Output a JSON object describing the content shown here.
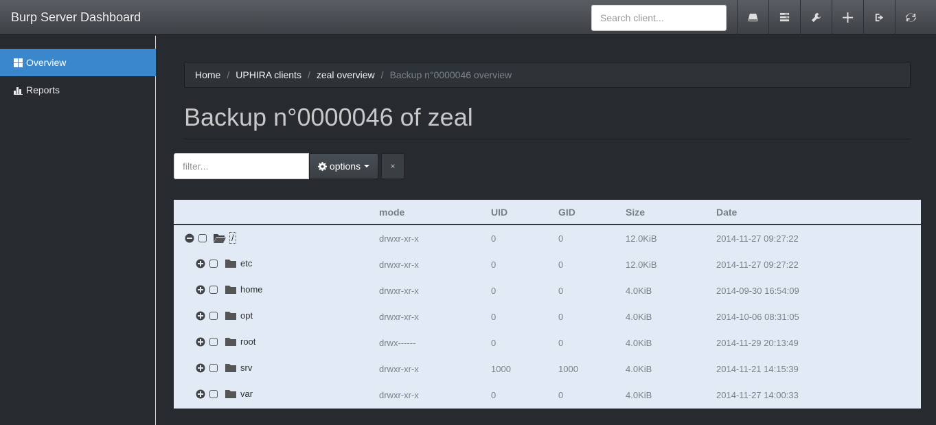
{
  "app": {
    "title": "Burp Server Dashboard"
  },
  "navbar": {
    "search_placeholder": "Search client...",
    "icons": [
      "hdd-icon",
      "tasks-icon",
      "wrench-icon",
      "screenshot-icon",
      "log-out-icon",
      "refresh-icon"
    ]
  },
  "sidebar": {
    "items": [
      {
        "label": "Overview",
        "icon": "th-large-icon",
        "active": true
      },
      {
        "label": "Reports",
        "icon": "stats-icon",
        "active": false
      }
    ]
  },
  "breadcrumb": [
    "Home",
    "UPHIRA clients",
    "zeal overview",
    "Backup n°0000046 overview"
  ],
  "page": {
    "title": "Backup n°0000046 of zeal"
  },
  "filter": {
    "placeholder": "filter...",
    "options_label": "options",
    "clear_label": "×"
  },
  "table": {
    "columns": [
      "",
      "mode",
      "UID",
      "GID",
      "Size",
      "Date"
    ],
    "rows": [
      {
        "name": "/",
        "expanded": true,
        "mode": "drwxr-xr-x",
        "uid": "0",
        "gid": "0",
        "size": "12.0KiB",
        "date": "2014-11-27 09:27:22"
      },
      {
        "name": "etc",
        "expanded": false,
        "mode": "drwxr-xr-x",
        "uid": "0",
        "gid": "0",
        "size": "12.0KiB",
        "date": "2014-11-27 09:27:22"
      },
      {
        "name": "home",
        "expanded": false,
        "mode": "drwxr-xr-x",
        "uid": "0",
        "gid": "0",
        "size": "4.0KiB",
        "date": "2014-09-30 16:54:09"
      },
      {
        "name": "opt",
        "expanded": false,
        "mode": "drwxr-xr-x",
        "uid": "0",
        "gid": "0",
        "size": "4.0KiB",
        "date": "2014-10-06 08:31:05"
      },
      {
        "name": "root",
        "expanded": false,
        "mode": "drwx------",
        "uid": "0",
        "gid": "0",
        "size": "4.0KiB",
        "date": "2014-11-29 20:13:49"
      },
      {
        "name": "srv",
        "expanded": false,
        "mode": "drwxr-xr-x",
        "uid": "1000",
        "gid": "1000",
        "size": "4.0KiB",
        "date": "2014-11-21 14:15:39"
      },
      {
        "name": "var",
        "expanded": false,
        "mode": "drwxr-xr-x",
        "uid": "0",
        "gid": "0",
        "size": "4.0KiB",
        "date": "2014-11-27 14:00:33"
      }
    ]
  },
  "colors": {
    "accent": "#3a87cc",
    "background": "#272b30",
    "table_bg": "#e2ebf5"
  }
}
